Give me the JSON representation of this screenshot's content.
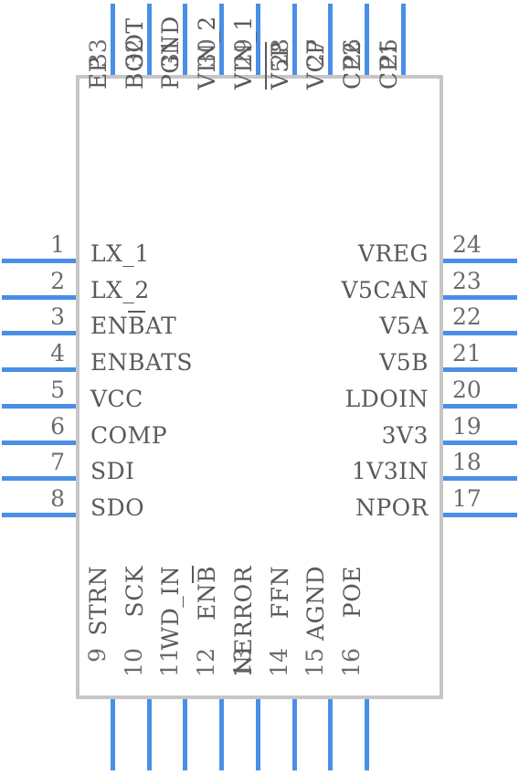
{
  "component": {
    "title": "IC pinout symbol",
    "body_color": "#c6c6c6",
    "lead_color": "#4a8fe7",
    "text_color": "#5a5a5a",
    "number_color": "#6b6b6b",
    "total_pins": 33
  },
  "pins": {
    "left": [
      {
        "number": "1",
        "label": "LX_1",
        "overline": ""
      },
      {
        "number": "2",
        "label": "LX_2",
        "overline": ""
      },
      {
        "number": "3",
        "label": "ENBAT",
        "overline": "B"
      },
      {
        "number": "4",
        "label": "ENBATS",
        "overline": ""
      },
      {
        "number": "5",
        "label": "VCC",
        "overline": ""
      },
      {
        "number": "6",
        "label": "COMP",
        "overline": ""
      },
      {
        "number": "7",
        "label": "SDI",
        "overline": ""
      },
      {
        "number": "8",
        "label": "SDO",
        "overline": ""
      }
    ],
    "bottom": [
      {
        "number": "9",
        "label": "STRN",
        "overline": ""
      },
      {
        "number": "10",
        "label": "SCK",
        "overline": ""
      },
      {
        "number": "11",
        "label": "WD_IN",
        "overline": ""
      },
      {
        "number": "12",
        "label": "ENB",
        "overline": "B"
      },
      {
        "number": "13",
        "label": "NERROR",
        "overline": ""
      },
      {
        "number": "14",
        "label": "FFN",
        "overline": ""
      },
      {
        "number": "15",
        "label": "AGND",
        "overline": ""
      },
      {
        "number": "16",
        "label": "POE",
        "overline": ""
      }
    ],
    "right": [
      {
        "number": "17",
        "label": "NPOR",
        "overline": ""
      },
      {
        "number": "18",
        "label": "1V3IN",
        "overline": ""
      },
      {
        "number": "19",
        "label": "3V3",
        "overline": ""
      },
      {
        "number": "20",
        "label": "LDOIN",
        "overline": ""
      },
      {
        "number": "21",
        "label": "V5B",
        "overline": ""
      },
      {
        "number": "22",
        "label": "V5A",
        "overline": ""
      },
      {
        "number": "23",
        "label": "V5CAN",
        "overline": ""
      },
      {
        "number": "24",
        "label": "VREG",
        "overline": ""
      }
    ],
    "top": [
      {
        "number": "25",
        "label": "CP1",
        "overline": ""
      },
      {
        "number": "26",
        "label": "CP2",
        "overline": ""
      },
      {
        "number": "27",
        "label": "VCP",
        "overline": ""
      },
      {
        "number": "28",
        "label": "V5P",
        "overline": "V5P"
      },
      {
        "number": "29",
        "label": "VIN_1",
        "overline": ""
      },
      {
        "number": "30",
        "label": "VIN_2",
        "overline": ""
      },
      {
        "number": "31",
        "label": "PGND",
        "overline": ""
      },
      {
        "number": "32",
        "label": "BOOT",
        "overline": ""
      },
      {
        "number": "33",
        "label": "EP",
        "overline": ""
      }
    ]
  }
}
